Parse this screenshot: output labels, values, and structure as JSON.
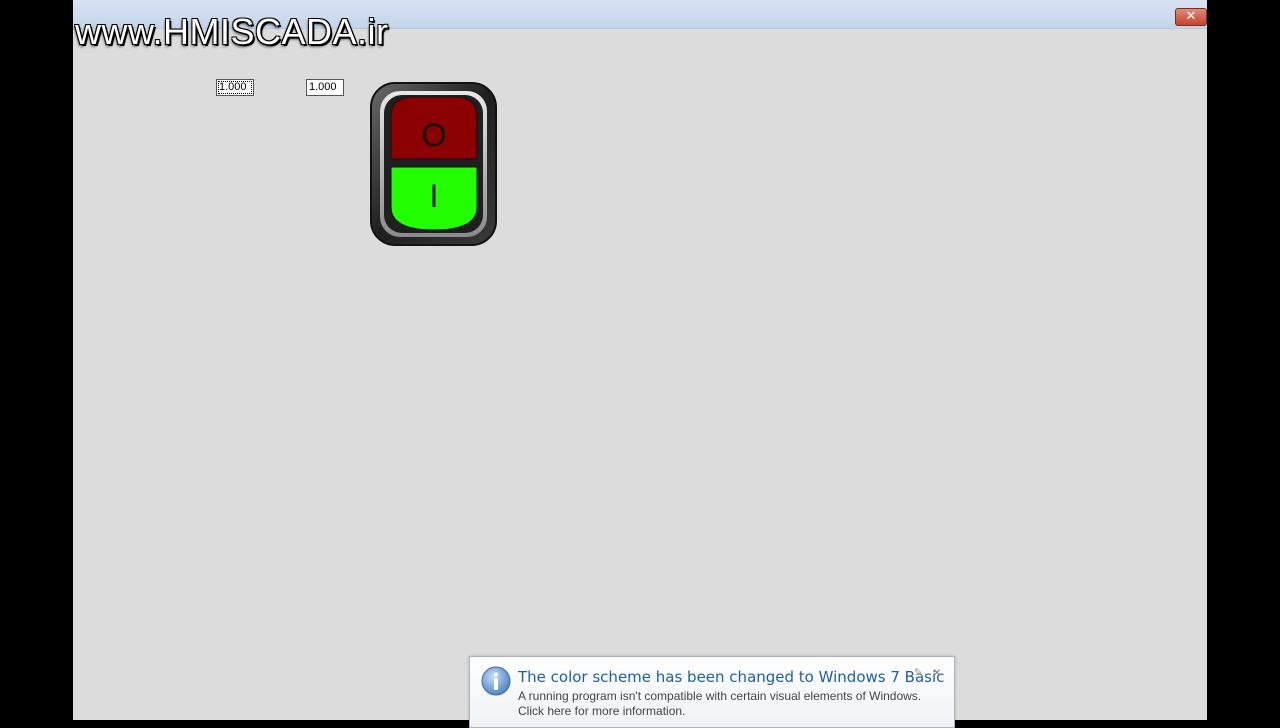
{
  "watermark": "www.HMISCADA.ir",
  "window": {
    "close_glyph": "✕"
  },
  "inputs": {
    "value1": "1.000",
    "value2": "1.000"
  },
  "pushbutton": {
    "stop_label": "O",
    "start_label": "I",
    "stop_color": "#8b0000",
    "start_color": "#22ff00"
  },
  "notification": {
    "title": "The color scheme has been changed to Windows 7 Basic",
    "line1": "A running program isn't compatible with certain visual elements of Windows.",
    "line2": "Click here for more information.",
    "pin_icon": "pin-icon",
    "close_glyph": "×"
  }
}
